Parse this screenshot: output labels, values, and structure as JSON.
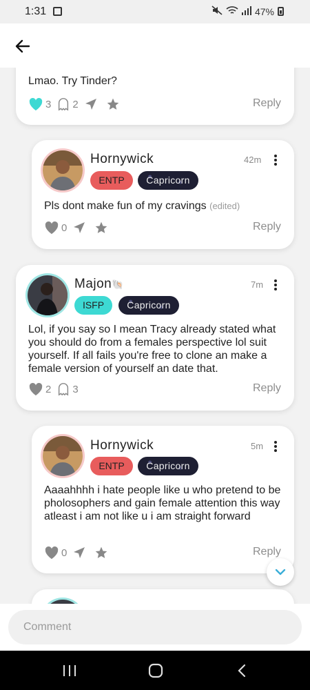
{
  "status_bar": {
    "time": "1:31",
    "battery": "47%"
  },
  "header": {
    "back_icon": "arrow-left-icon"
  },
  "comments": [
    {
      "text": "Lmao. Try Tinder?",
      "likes": "3",
      "ghosts": "2",
      "reply": "Reply"
    },
    {
      "username": "Hornywick",
      "time": "42m",
      "mbti": "ENTP",
      "zodiac": "Capricorn",
      "text": "Pls dont make fun of my cravings",
      "edited": "(edited)",
      "likes": "0",
      "reply": "Reply"
    },
    {
      "username": "Majon",
      "emoji": "🐚",
      "time": "7m",
      "mbti": "ISFP",
      "zodiac": "Capricorn",
      "text": "Lol, if you say so I mean Tracy already stated what you should do from a females perspective lol suit yourself. If all fails you're free to clone an make a female version of yourself an date that.",
      "likes": "2",
      "ghosts": "3",
      "reply": "Reply"
    },
    {
      "username": "Hornywick",
      "time": "5m",
      "mbti": "ENTP",
      "zodiac": "Capricorn",
      "text": "Aaaahhhh i hate people like u who pretend to be pholosophers and gain female attention this way atleast i am not like u i am straight forward",
      "likes": "0",
      "reply": "Reply"
    }
  ],
  "comment_bar": {
    "placeholder": "Comment"
  },
  "colors": {
    "entp": "#e85c5c",
    "isfp": "#3dd9d3",
    "zodiac_bg": "#1e1f33",
    "like_active": "#3dd9d3"
  }
}
